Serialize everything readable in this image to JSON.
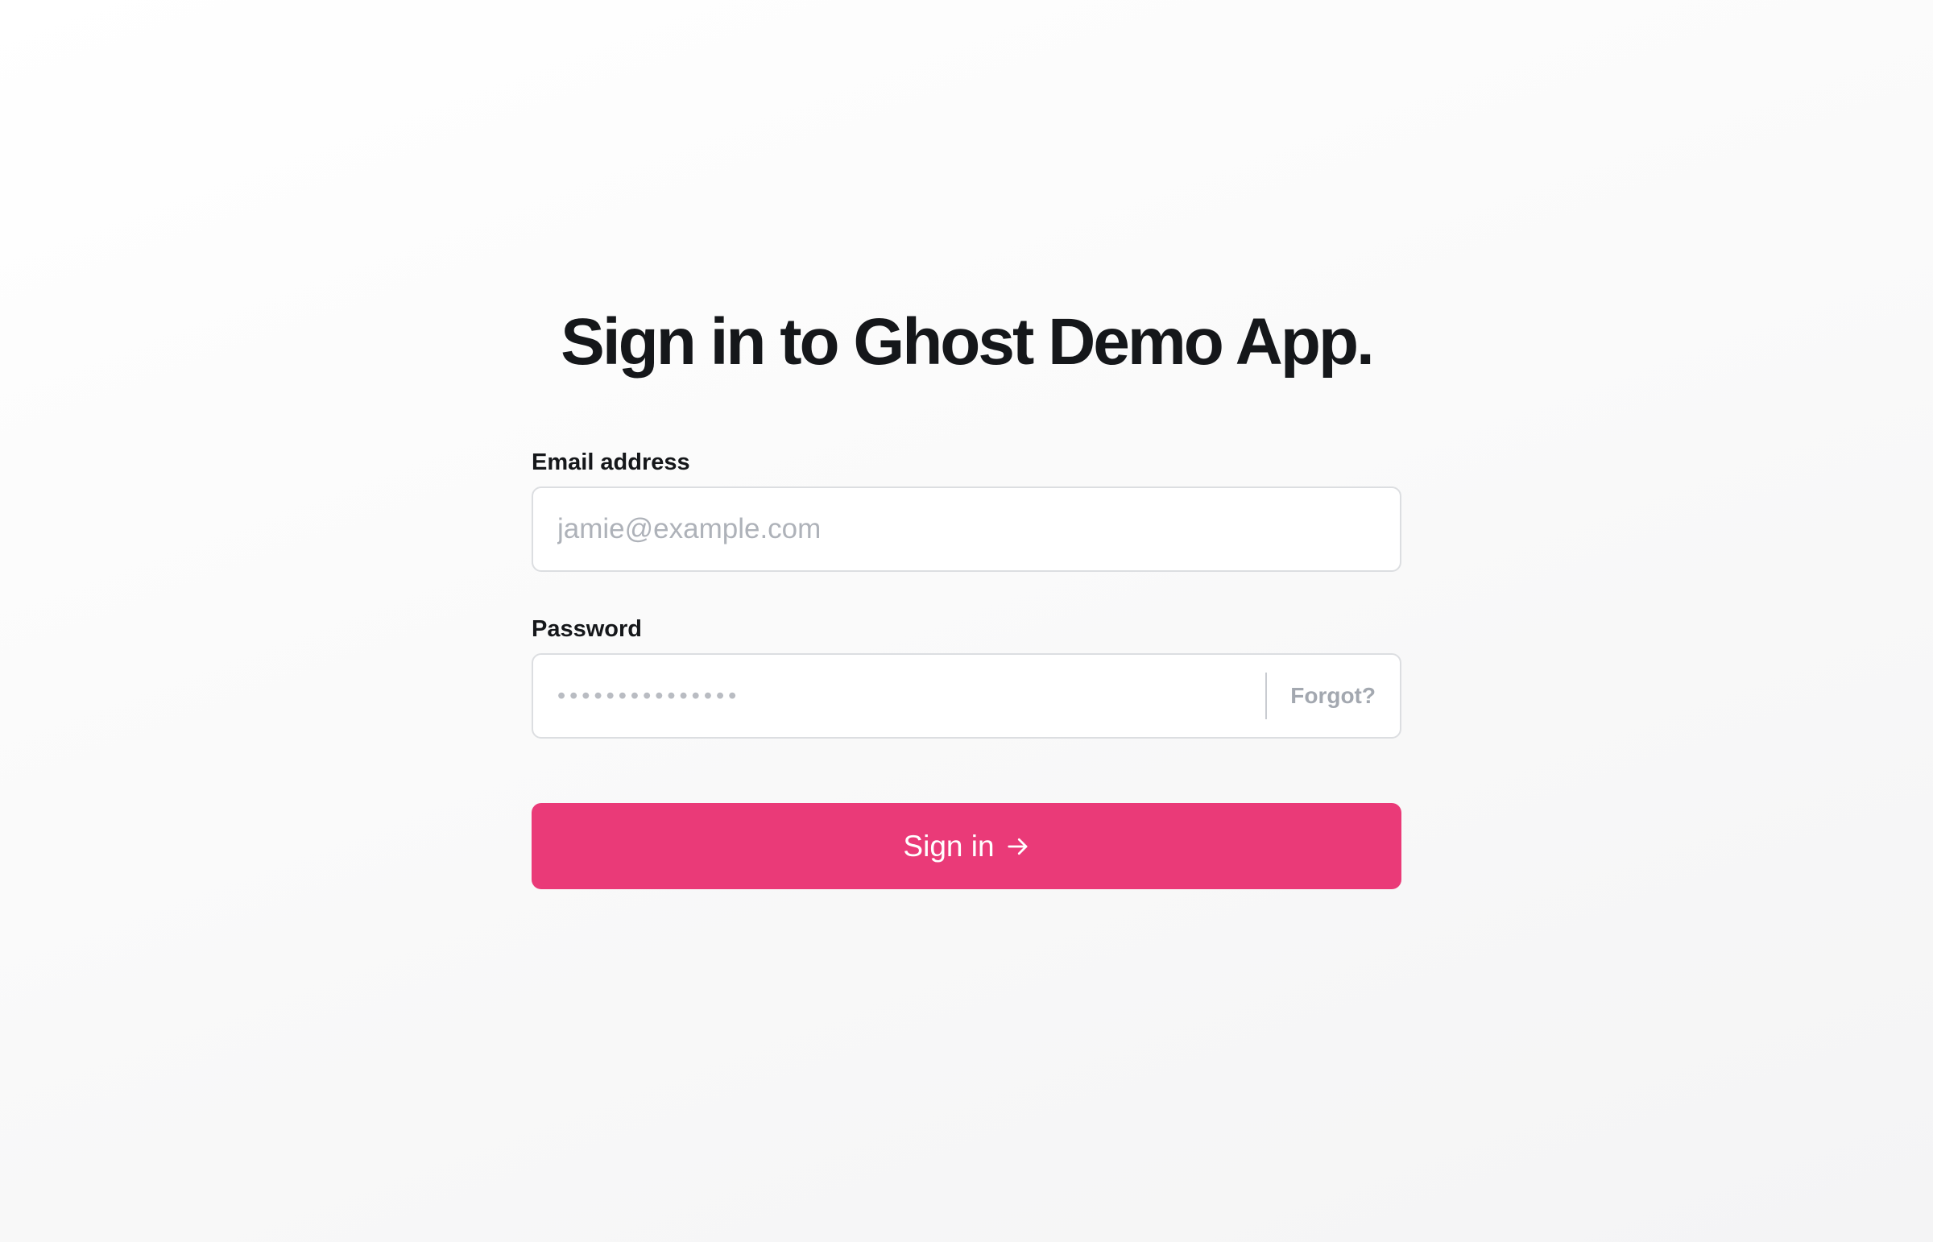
{
  "page": {
    "title": "Sign in to Ghost Demo App."
  },
  "form": {
    "email": {
      "label": "Email address",
      "placeholder": "jamie@example.com",
      "value": ""
    },
    "password": {
      "label": "Password",
      "placeholder": "•••••••••••••••",
      "value": "",
      "forgot_label": "Forgot?"
    },
    "submit": {
      "label": "Sign in",
      "icon": "arrow-right-icon"
    }
  },
  "colors": {
    "accent": "#ea3a78",
    "text": "#15171a",
    "placeholder": "#aeb2b9",
    "muted": "#a3a8b0",
    "border": "#dcdee1"
  }
}
